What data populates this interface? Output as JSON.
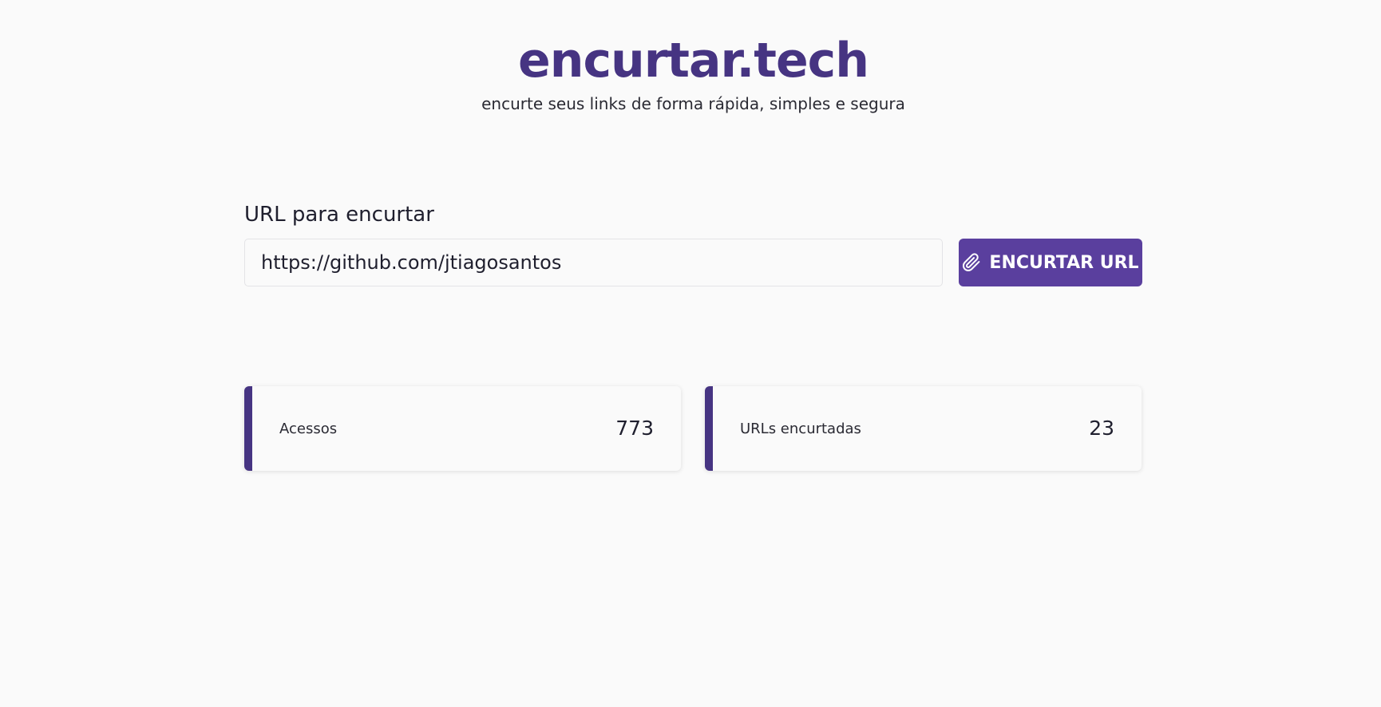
{
  "header": {
    "logo_text": "encurtar.tech",
    "tagline": "encurte seus links de forma rápida, simples e segura"
  },
  "form": {
    "label": "URL para encurtar",
    "input_value": "https://github.com/jtiagosantos",
    "button_label": "ENCURTAR URL",
    "button_icon": "paperclip-icon"
  },
  "stats": {
    "accesses": {
      "label": "Acessos",
      "value": "773"
    },
    "urls": {
      "label": "URLs encurtadas",
      "value": "23"
    }
  },
  "colors": {
    "brand": "#463482",
    "button": "#5a3f9e",
    "background": "#fafafa"
  }
}
